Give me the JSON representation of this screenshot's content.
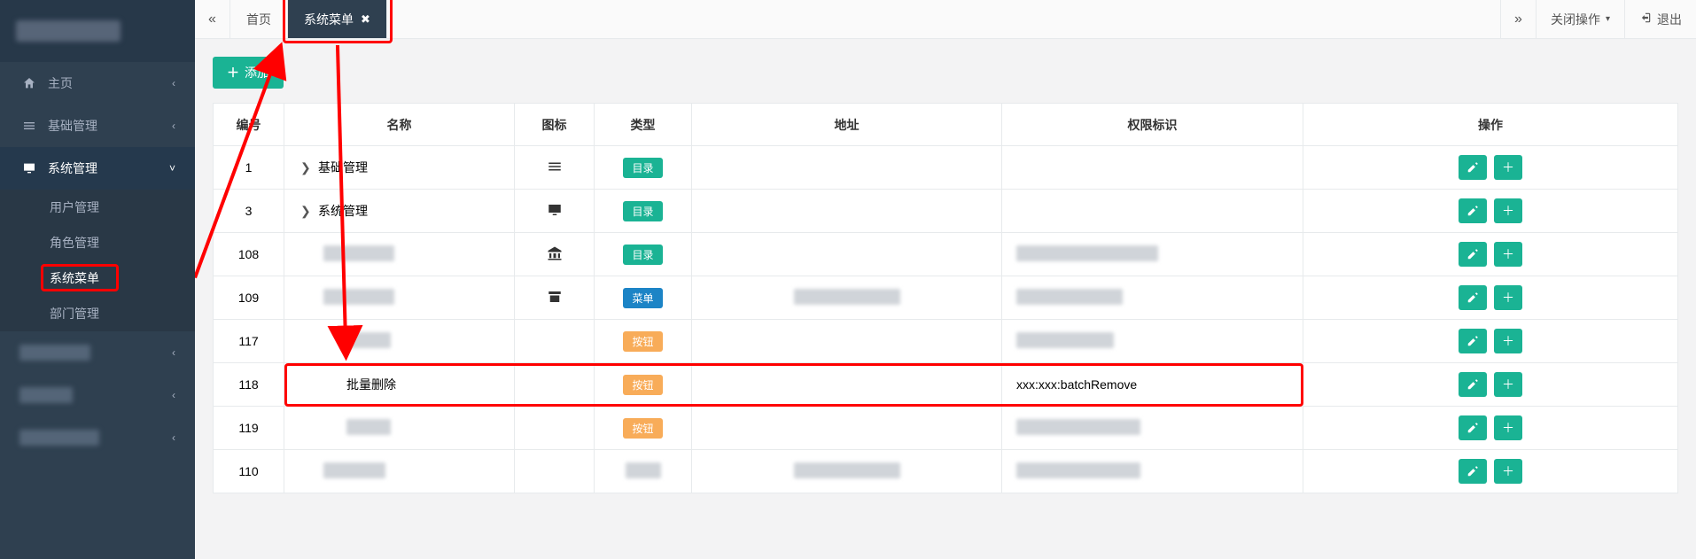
{
  "sidebar": {
    "items": [
      {
        "icon": "home",
        "label": "主页",
        "chev": "‹"
      },
      {
        "icon": "list",
        "label": "基础管理",
        "chev": "‹"
      },
      {
        "icon": "monitor",
        "label": "系统管理",
        "chev": "˅",
        "children": [
          {
            "label": "用户管理"
          },
          {
            "label": "角色管理"
          },
          {
            "label": "系统菜单",
            "selected": true
          },
          {
            "label": "部门管理"
          }
        ]
      }
    ]
  },
  "tabbar": {
    "prev": "«",
    "next": "»",
    "tabs": [
      {
        "label": "首页",
        "closable": false
      },
      {
        "label": "系统菜单",
        "closable": true,
        "active": true
      }
    ],
    "closeOps": "关闭操作",
    "exit": "退出"
  },
  "toolbar": {
    "add": "添加"
  },
  "table": {
    "headers": {
      "id": "编号",
      "name": "名称",
      "icon": "图标",
      "type": "类型",
      "addr": "地址",
      "perm": "权限标识",
      "ops": "操作"
    },
    "typeLabels": {
      "dir": "目录",
      "menu": "菜单",
      "btn": "按钮"
    },
    "rows": [
      {
        "id": "1",
        "name": "基础管理",
        "expand": true,
        "indent": 0,
        "icon": "menu",
        "type": "dir",
        "addr": "",
        "perm": ""
      },
      {
        "id": "3",
        "name": "系统管理",
        "expand": true,
        "indent": 0,
        "icon": "monitor",
        "type": "dir",
        "addr": "",
        "perm": ""
      },
      {
        "id": "108",
        "name": "",
        "expand": false,
        "indent": 1,
        "icon": "bank",
        "type": "dir",
        "addr": "",
        "perm": "",
        "blurName": 80,
        "blurPerm": 160
      },
      {
        "id": "109",
        "name": "",
        "expand": false,
        "indent": 1,
        "icon": "archive",
        "type": "menu",
        "addr": "",
        "perm": "",
        "blurName": 80,
        "blurAddr": 120,
        "blurPerm": 120
      },
      {
        "id": "117",
        "name": "",
        "expand": false,
        "indent": 2,
        "icon": "",
        "type": "btn",
        "addr": "",
        "perm": "",
        "blurName": 50,
        "blurPerm": 110
      },
      {
        "id": "118",
        "name": "批量删除",
        "expand": false,
        "indent": 2,
        "icon": "",
        "type": "btn",
        "addr": "",
        "perm": "xxx:xxx:batchRemove",
        "highlight": true
      },
      {
        "id": "119",
        "name": "",
        "expand": false,
        "indent": 2,
        "icon": "",
        "type": "btn",
        "addr": "",
        "perm": "",
        "blurName": 50,
        "blurPerm": 140
      },
      {
        "id": "110",
        "name": "",
        "expand": false,
        "indent": 1,
        "icon": "",
        "type": "",
        "addr": "",
        "perm": "",
        "blurName": 70,
        "blurAddr": 120,
        "blurPerm": 140
      }
    ]
  }
}
